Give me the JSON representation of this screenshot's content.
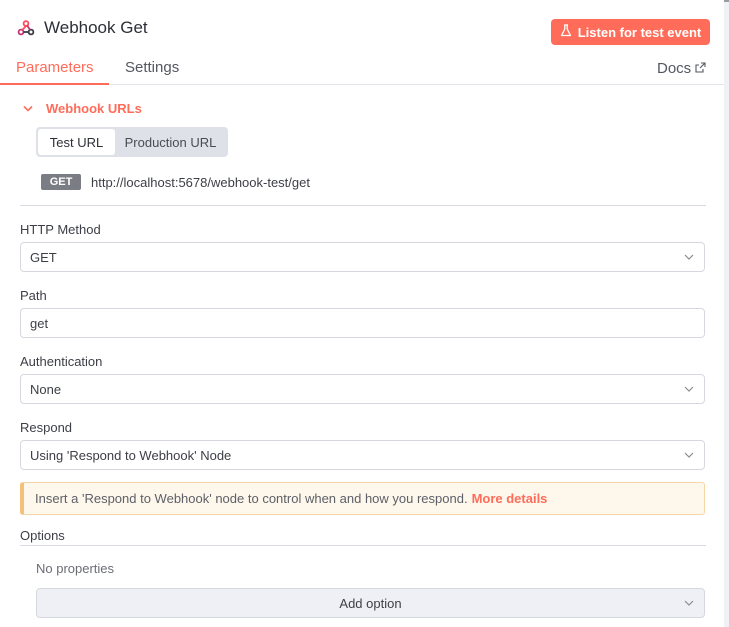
{
  "header": {
    "title": "Webhook Get",
    "listen_button": "Listen for test event",
    "tabs": [
      {
        "label": "Parameters",
        "active": true
      },
      {
        "label": "Settings",
        "active": false
      }
    ],
    "docs_label": "Docs"
  },
  "webhook_urls": {
    "section_title": "Webhook URLs",
    "toggle_options": [
      "Test URL",
      "Production URL"
    ],
    "selected_option": "Test URL",
    "method_badge": "GET",
    "url": "http://localhost:5678/webhook-test/get"
  },
  "fields": {
    "http_method": {
      "label": "HTTP Method",
      "value": "GET"
    },
    "path": {
      "label": "Path",
      "value": "get"
    },
    "authentication": {
      "label": "Authentication",
      "value": "None"
    },
    "respond": {
      "label": "Respond",
      "value": "Using 'Respond to Webhook' Node"
    }
  },
  "notice": {
    "text": "Insert a 'Respond to Webhook' node to control when and how you respond.",
    "link": "More details"
  },
  "options": {
    "label": "Options",
    "empty_text": "No properties",
    "add_button": "Add option"
  },
  "colors": {
    "accent": "#ff6d5a",
    "notice_bg": "#fef7ec",
    "badge_bg": "#7b7d85"
  },
  "icons": {
    "title": "webhook-icon",
    "listen": "flask-icon",
    "docs": "external-link-icon",
    "section": "chevron-down-icon",
    "select": "chevron-down-icon"
  }
}
